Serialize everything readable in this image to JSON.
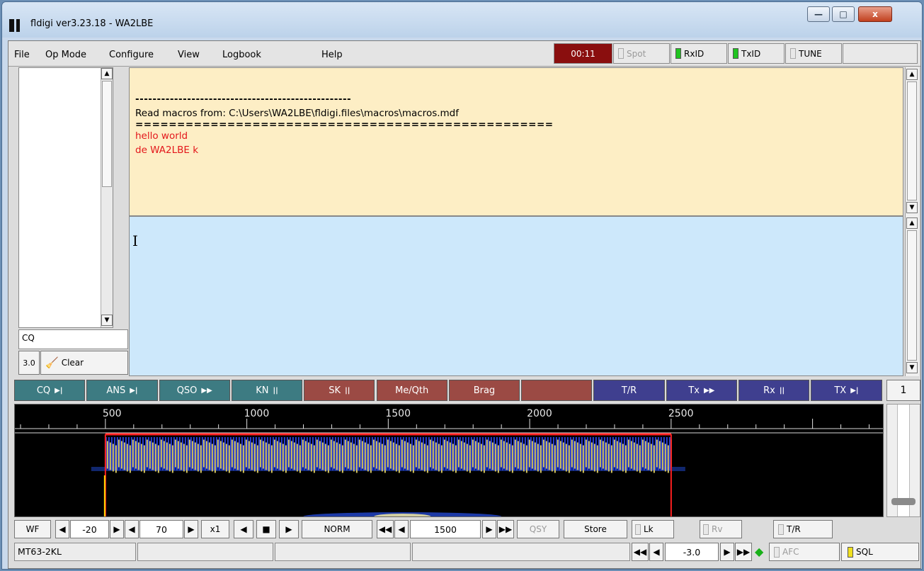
{
  "window": {
    "title": "fldigi ver3.23.18 - WA2LBE",
    "minimize": "—",
    "maximize": "□",
    "close": "x"
  },
  "menu": {
    "items": [
      "File",
      "Op Mode",
      "Configure",
      "View",
      "Logbook",
      "Help"
    ]
  },
  "toolbar": {
    "timer": "00:11",
    "spot": "Spot",
    "rxid": "RxID",
    "txid": "TxID",
    "tune": "TUNE"
  },
  "left_panel": {
    "callsign_input": "CQ",
    "zoom": "3.0",
    "clear_label": "Clear"
  },
  "rx_text": {
    "line1": "--------------------------------------------------",
    "line2": "Read macros from: C:\\Users\\WA2LBE\\fldigi.files\\macros\\macros.mdf",
    "line3": "==================================================",
    "line4": "hello world",
    "line5": "de WA2LBE k"
  },
  "tx_text": {
    "cursor": "I"
  },
  "macros": [
    {
      "label": "CQ",
      "glyph": "▶|",
      "color": "#3d7b82"
    },
    {
      "label": "ANS",
      "glyph": "▶|",
      "color": "#3d7b82"
    },
    {
      "label": "QSO",
      "glyph": "▶▶",
      "color": "#3d7b82"
    },
    {
      "label": "KN",
      "glyph": "||",
      "color": "#3d7b82"
    },
    {
      "label": "SK",
      "glyph": "||",
      "color": "#9b4a44"
    },
    {
      "label": "Me/Qth",
      "glyph": "",
      "color": "#9b4a44"
    },
    {
      "label": "Brag",
      "glyph": "",
      "color": "#9b4a44"
    },
    {
      "label": "",
      "glyph": "",
      "color": "#9b4a44"
    },
    {
      "label": "T/R",
      "glyph": "",
      "color": "#3f3f8f"
    },
    {
      "label": "Tx",
      "glyph": "▶▶",
      "color": "#3f3f8f"
    },
    {
      "label": "Rx",
      "glyph": "||",
      "color": "#3f3f8f"
    },
    {
      "label": "TX",
      "glyph": "▶|",
      "color": "#3f3f8f"
    }
  ],
  "macro_page": "1",
  "waterfall": {
    "scale": [
      "500",
      "1000",
      "1500",
      "2000",
      "2500"
    ],
    "signal_start_hz": 500,
    "signal_end_hz": 2500
  },
  "controls": {
    "wf_mode": "WF",
    "ref_level": "-20",
    "range": "70",
    "zoom": "x1",
    "norm": "NORM",
    "freq": "1500",
    "qsy": "QSY",
    "store": "Store",
    "lk": "Lk",
    "rv": "Rv",
    "tr": "T/R"
  },
  "status": {
    "mode": "MT63-2KL",
    "s2n": "-3.0",
    "afc": "AFC",
    "sql": "SQL"
  },
  "colors": {
    "rx_bg": "#fdeec5",
    "tx_bg": "#cde8fb",
    "timer_bg": "#8a0e0e"
  }
}
